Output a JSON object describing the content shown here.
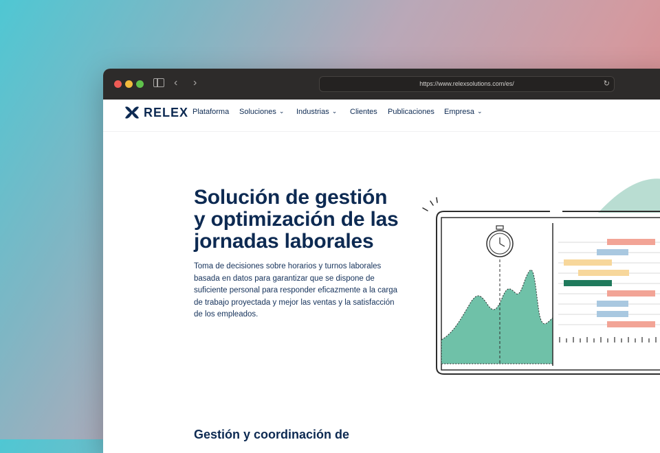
{
  "browser": {
    "url": "https://www.relexsolutions.com/es/"
  },
  "brand": {
    "name": "RELEX",
    "color": "#0d2a52",
    "accent": "#6cc0a8"
  },
  "nav": {
    "items": [
      {
        "label": "Plataforma",
        "dropdown": false
      },
      {
        "label": "Soluciones",
        "dropdown": true
      },
      {
        "label": "Industrias",
        "dropdown": true
      },
      {
        "label": "Clientes",
        "dropdown": false
      },
      {
        "label": "Publicaciones",
        "dropdown": false
      },
      {
        "label": "Empresa",
        "dropdown": true
      }
    ]
  },
  "hero": {
    "title_lines": [
      "Solución de gestión",
      "y optimización de las",
      "jornadas laborales"
    ],
    "description_lines": [
      "Toma de decisiones sobre horarios y turnos laborales",
      "basada en datos para garantizar que se dispone de",
      "suficiente personal para responder eficazmente a la carga",
      "de trabajo proyectada y mejor las ventas y la satisfacción",
      "de los empleados."
    ]
  },
  "next_section": {
    "title": "Gestión y coordinación de"
  }
}
